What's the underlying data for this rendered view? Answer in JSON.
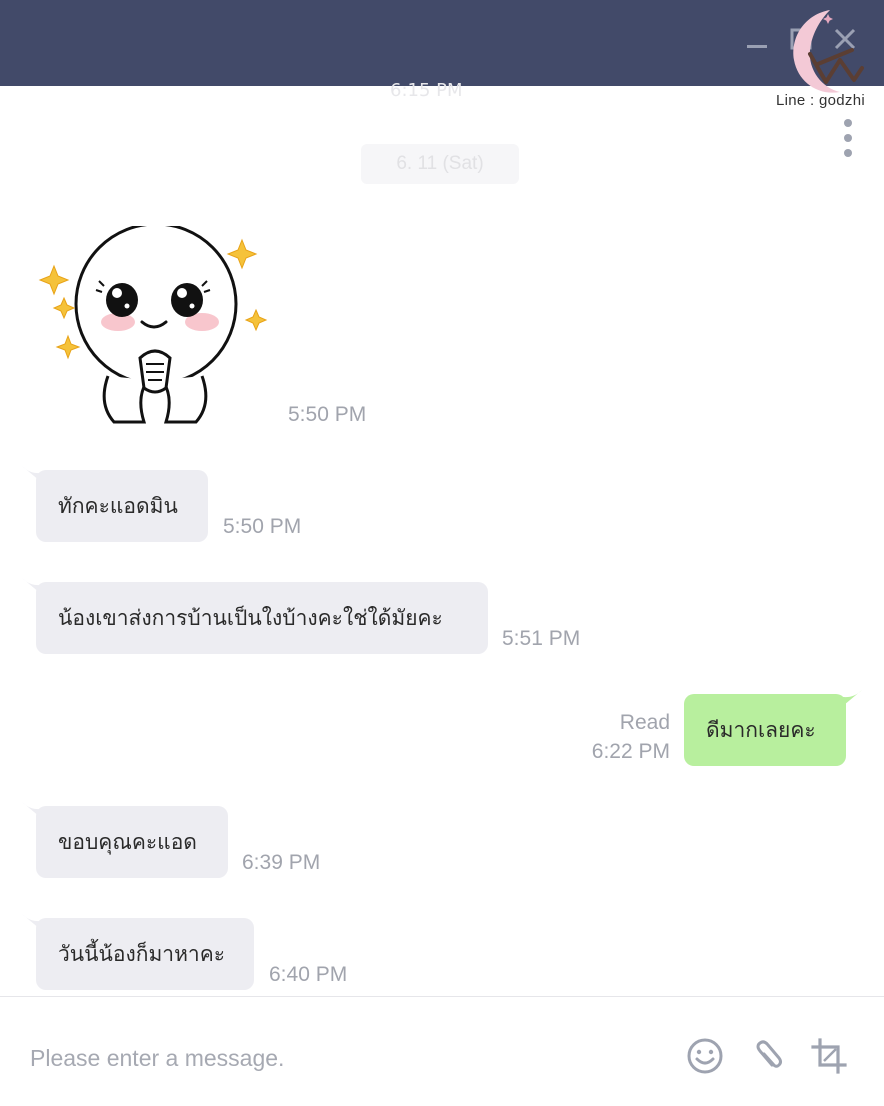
{
  "window": {
    "minimize_icon": "minimize-icon",
    "maximize_icon": "maximize-icon",
    "close_icon": "close-icon"
  },
  "watermark": {
    "text": "Line : godzhi",
    "logo": "crescent-moon-logo"
  },
  "chat": {
    "faded_time": "6:15 PM",
    "date_separator": "6. 11 (Sat)",
    "more_icon": "more-vertical-icon",
    "messages": [
      {
        "id": "m1",
        "direction": "incoming",
        "kind": "sticker",
        "sticker": "praying-moon-face-sticker",
        "time": "5:50 PM"
      },
      {
        "id": "m2",
        "direction": "incoming",
        "kind": "text",
        "text": "ทักคะแอดมิน",
        "time": "5:50 PM"
      },
      {
        "id": "m3",
        "direction": "incoming",
        "kind": "text",
        "text": "น้องเขาส่งการบ้านเป็นใงบ้างคะใช่ใด้มัยคะ",
        "time": "5:51 PM"
      },
      {
        "id": "m4",
        "direction": "outgoing",
        "kind": "text",
        "text": "ดีมากเลยคะ",
        "status": "Read",
        "time": "6:22 PM"
      },
      {
        "id": "m5",
        "direction": "incoming",
        "kind": "text",
        "text": "ขอบคุณคะแอด",
        "time": "6:39 PM"
      },
      {
        "id": "m6",
        "direction": "incoming",
        "kind": "text",
        "text": "วันนี้น้องก็มาหาคะ",
        "time": "6:40 PM"
      }
    ]
  },
  "composer": {
    "placeholder": "Please enter a message.",
    "value": "",
    "emoji_icon": "emoji-icon",
    "attach_icon": "paperclip-icon",
    "screenshot_icon": "crop-icon"
  },
  "colors": {
    "titlebar": "#424a69",
    "incoming_bubble": "#ededf2",
    "outgoing_bubble": "#b8ef9e",
    "timestamp": "#a1a4ad"
  }
}
